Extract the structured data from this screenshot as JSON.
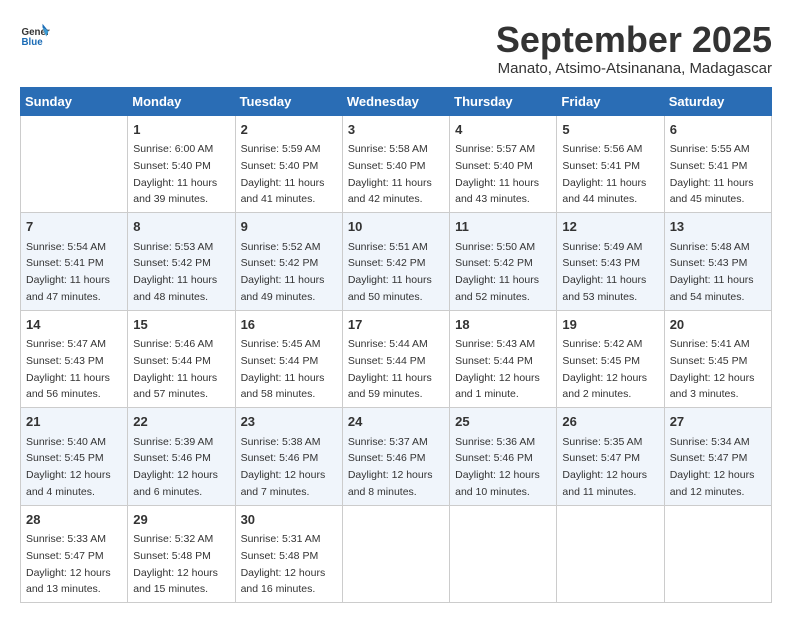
{
  "header": {
    "logo_general": "General",
    "logo_blue": "Blue",
    "month_title": "September 2025",
    "subtitle": "Manato, Atsimo-Atsinanana, Madagascar"
  },
  "columns": [
    "Sunday",
    "Monday",
    "Tuesday",
    "Wednesday",
    "Thursday",
    "Friday",
    "Saturday"
  ],
  "weeks": [
    [
      {
        "day": "",
        "info": ""
      },
      {
        "day": "1",
        "info": "Sunrise: 6:00 AM\nSunset: 5:40 PM\nDaylight: 11 hours\nand 39 minutes."
      },
      {
        "day": "2",
        "info": "Sunrise: 5:59 AM\nSunset: 5:40 PM\nDaylight: 11 hours\nand 41 minutes."
      },
      {
        "day": "3",
        "info": "Sunrise: 5:58 AM\nSunset: 5:40 PM\nDaylight: 11 hours\nand 42 minutes."
      },
      {
        "day": "4",
        "info": "Sunrise: 5:57 AM\nSunset: 5:40 PM\nDaylight: 11 hours\nand 43 minutes."
      },
      {
        "day": "5",
        "info": "Sunrise: 5:56 AM\nSunset: 5:41 PM\nDaylight: 11 hours\nand 44 minutes."
      },
      {
        "day": "6",
        "info": "Sunrise: 5:55 AM\nSunset: 5:41 PM\nDaylight: 11 hours\nand 45 minutes."
      }
    ],
    [
      {
        "day": "7",
        "info": "Sunrise: 5:54 AM\nSunset: 5:41 PM\nDaylight: 11 hours\nand 47 minutes."
      },
      {
        "day": "8",
        "info": "Sunrise: 5:53 AM\nSunset: 5:42 PM\nDaylight: 11 hours\nand 48 minutes."
      },
      {
        "day": "9",
        "info": "Sunrise: 5:52 AM\nSunset: 5:42 PM\nDaylight: 11 hours\nand 49 minutes."
      },
      {
        "day": "10",
        "info": "Sunrise: 5:51 AM\nSunset: 5:42 PM\nDaylight: 11 hours\nand 50 minutes."
      },
      {
        "day": "11",
        "info": "Sunrise: 5:50 AM\nSunset: 5:42 PM\nDaylight: 11 hours\nand 52 minutes."
      },
      {
        "day": "12",
        "info": "Sunrise: 5:49 AM\nSunset: 5:43 PM\nDaylight: 11 hours\nand 53 minutes."
      },
      {
        "day": "13",
        "info": "Sunrise: 5:48 AM\nSunset: 5:43 PM\nDaylight: 11 hours\nand 54 minutes."
      }
    ],
    [
      {
        "day": "14",
        "info": "Sunrise: 5:47 AM\nSunset: 5:43 PM\nDaylight: 11 hours\nand 56 minutes."
      },
      {
        "day": "15",
        "info": "Sunrise: 5:46 AM\nSunset: 5:44 PM\nDaylight: 11 hours\nand 57 minutes."
      },
      {
        "day": "16",
        "info": "Sunrise: 5:45 AM\nSunset: 5:44 PM\nDaylight: 11 hours\nand 58 minutes."
      },
      {
        "day": "17",
        "info": "Sunrise: 5:44 AM\nSunset: 5:44 PM\nDaylight: 11 hours\nand 59 minutes."
      },
      {
        "day": "18",
        "info": "Sunrise: 5:43 AM\nSunset: 5:44 PM\nDaylight: 12 hours\nand 1 minute."
      },
      {
        "day": "19",
        "info": "Sunrise: 5:42 AM\nSunset: 5:45 PM\nDaylight: 12 hours\nand 2 minutes."
      },
      {
        "day": "20",
        "info": "Sunrise: 5:41 AM\nSunset: 5:45 PM\nDaylight: 12 hours\nand 3 minutes."
      }
    ],
    [
      {
        "day": "21",
        "info": "Sunrise: 5:40 AM\nSunset: 5:45 PM\nDaylight: 12 hours\nand 4 minutes."
      },
      {
        "day": "22",
        "info": "Sunrise: 5:39 AM\nSunset: 5:46 PM\nDaylight: 12 hours\nand 6 minutes."
      },
      {
        "day": "23",
        "info": "Sunrise: 5:38 AM\nSunset: 5:46 PM\nDaylight: 12 hours\nand 7 minutes."
      },
      {
        "day": "24",
        "info": "Sunrise: 5:37 AM\nSunset: 5:46 PM\nDaylight: 12 hours\nand 8 minutes."
      },
      {
        "day": "25",
        "info": "Sunrise: 5:36 AM\nSunset: 5:46 PM\nDaylight: 12 hours\nand 10 minutes."
      },
      {
        "day": "26",
        "info": "Sunrise: 5:35 AM\nSunset: 5:47 PM\nDaylight: 12 hours\nand 11 minutes."
      },
      {
        "day": "27",
        "info": "Sunrise: 5:34 AM\nSunset: 5:47 PM\nDaylight: 12 hours\nand 12 minutes."
      }
    ],
    [
      {
        "day": "28",
        "info": "Sunrise: 5:33 AM\nSunset: 5:47 PM\nDaylight: 12 hours\nand 13 minutes."
      },
      {
        "day": "29",
        "info": "Sunrise: 5:32 AM\nSunset: 5:48 PM\nDaylight: 12 hours\nand 15 minutes."
      },
      {
        "day": "30",
        "info": "Sunrise: 5:31 AM\nSunset: 5:48 PM\nDaylight: 12 hours\nand 16 minutes."
      },
      {
        "day": "",
        "info": ""
      },
      {
        "day": "",
        "info": ""
      },
      {
        "day": "",
        "info": ""
      },
      {
        "day": "",
        "info": ""
      }
    ]
  ]
}
